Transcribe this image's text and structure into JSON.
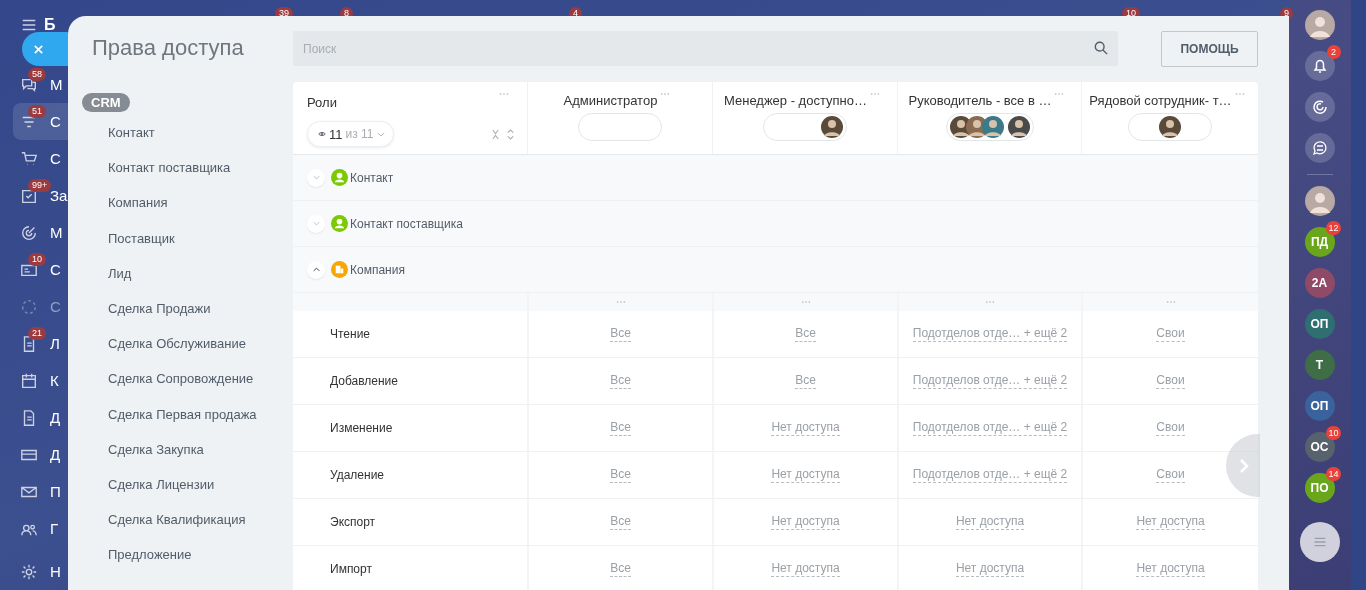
{
  "portal_sidebar": {
    "brand": "Б",
    "items": [
      {
        "label": "М",
        "badge": "58",
        "selected": false,
        "dimmed": false
      },
      {
        "label": "С",
        "badge": "51",
        "selected": true,
        "dimmed": false
      },
      {
        "label": "С",
        "selected": false,
        "dimmed": false
      },
      {
        "label": "За",
        "badge": "99+",
        "selected": false,
        "dimmed": false
      },
      {
        "label": "М",
        "selected": false,
        "dimmed": false
      },
      {
        "label": "С",
        "badge": "10",
        "selected": false,
        "dimmed": false
      },
      {
        "label": "С",
        "selected": false,
        "dimmed": true
      },
      {
        "label": "Л",
        "badge": "21",
        "selected": false,
        "dimmed": false
      },
      {
        "label": "К",
        "selected": false,
        "dimmed": false
      },
      {
        "label": "Д",
        "selected": false,
        "dimmed": false
      },
      {
        "label": "Д",
        "selected": false,
        "dimmed": false
      },
      {
        "label": "П",
        "selected": false,
        "dimmed": false
      },
      {
        "label": "Г",
        "selected": false,
        "dimmed": false
      },
      {
        "label": "Н",
        "selected": false,
        "dimmed": false
      }
    ]
  },
  "top_badges": [
    "39",
    "8",
    "4",
    "10",
    "9"
  ],
  "panel": {
    "title": "Права доступа",
    "search": {
      "placeholder": "Поиск"
    },
    "help_button": "ПОМОЩЬ",
    "menu": {
      "group": "CRM",
      "items": [
        "Контакт",
        "Контакт поставщика",
        "Компания",
        "Поставщик",
        "Лид",
        "Сделка Продажи",
        "Сделка Обслуживание",
        "Сделка Сопровождение",
        "Сделка Первая продажа",
        "Сделка Закупка",
        "Сделка Лицензии",
        "Сделка Квалификация",
        "Предложение"
      ]
    },
    "table": {
      "roles_header": {
        "title": "Роли",
        "shown": "11",
        "total": "из 11"
      },
      "columns": [
        {
          "title": "Администратор"
        },
        {
          "title": "Менеджер - доступно…",
          "avatars": [
            {
              "kind": "single"
            }
          ]
        },
        {
          "title": "Руководитель - все в …",
          "avatars": [
            {
              "kind": "stacked"
            },
            {
              "kind": "stacked"
            },
            {
              "kind": "stacked"
            },
            {
              "kind": "single"
            }
          ]
        },
        {
          "title": "Рядовой сотрудник- т…",
          "avatars": [
            {
              "kind": "single"
            }
          ]
        }
      ],
      "sections": [
        {
          "title": "Контакт",
          "expanded": false,
          "kind": "person",
          "color": "#7bc900"
        },
        {
          "title": "Контакт поставщика",
          "expanded": false,
          "kind": "person",
          "color": "#7bc900"
        },
        {
          "title": "Компания",
          "expanded": true,
          "kind": "building",
          "color": "#f7a700"
        }
      ],
      "rows": [
        {
          "label": "Чтение",
          "values": [
            "Все",
            "Все",
            "Подотделов отде… + ещё 2",
            "Свои"
          ]
        },
        {
          "label": "Добавление",
          "values": [
            "Все",
            "Все",
            "Подотделов отде… + ещё 2",
            "Свои"
          ]
        },
        {
          "label": "Изменение",
          "values": [
            "Все",
            "Нет доступа",
            "Подотделов отде… + ещё 2",
            "Свои"
          ]
        },
        {
          "label": "Удаление",
          "values": [
            "Все",
            "Нет доступа",
            "Подотделов отде… + ещё 2",
            "Свои"
          ]
        },
        {
          "label": "Экспорт",
          "values": [
            "Все",
            "Нет доступа",
            "Нет доступа",
            "Нет доступа"
          ]
        },
        {
          "label": "Импорт",
          "values": [
            "Все",
            "Нет доступа",
            "Нет доступа",
            "Нет доступа"
          ]
        }
      ]
    }
  },
  "right_sidebar": [
    {
      "kind": "avatar"
    },
    {
      "kind": "bell",
      "badge": "2"
    },
    {
      "kind": "spiral"
    },
    {
      "kind": "chat"
    },
    {
      "kind": "divider"
    },
    {
      "kind": "avatar"
    },
    {
      "kind": "initials",
      "label": "ПД",
      "color": "#6aa61b",
      "badge": "12"
    },
    {
      "kind": "initials",
      "label": "2А",
      "color": "#8e4a66"
    },
    {
      "kind": "initials",
      "label": "ОП",
      "color": "#2f6f72"
    },
    {
      "kind": "initials",
      "label": "Т",
      "color": "#3f6e46"
    },
    {
      "kind": "initials",
      "label": "ОП",
      "color": "#3a629c"
    },
    {
      "kind": "initials",
      "label": "ОС",
      "color": "#58626d",
      "badge": "10"
    },
    {
      "kind": "initials",
      "label": "ПО",
      "color": "#6aa61b",
      "badge": "14"
    },
    {
      "kind": "menu"
    }
  ]
}
